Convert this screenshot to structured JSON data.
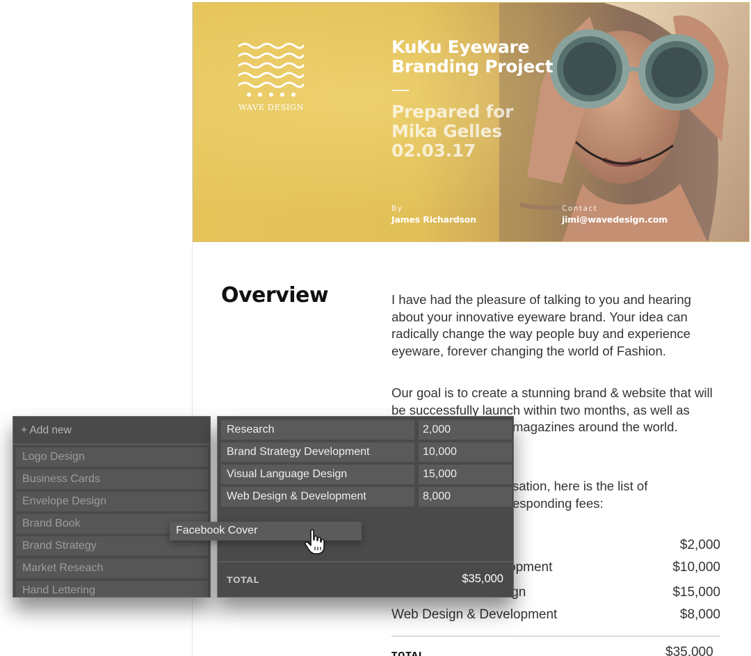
{
  "hero": {
    "logo_text": "WAVE DESIGN",
    "title_line1": "KuKu Eyeware",
    "title_line2": "Branding Project",
    "prepared_line1": "Prepared for",
    "prepared_line2": "Mika Gelles",
    "prepared_line3": "02.03.17",
    "by_label": "By",
    "by_value": "James Richardson",
    "contact_label": "Contact",
    "contact_value": "jimi@wavedesign.com"
  },
  "overview": {
    "heading": "Overview",
    "para1": "I have had the pleasure of talking to you and hearing about your innovative eyeware brand. Your idea can radically change the way people buy and experience eyeware, forever changing the world of Fashion.",
    "para2": "Our goal is to create a stunning brand & website that will be successfully launch within two months, as well as",
    "para2_tail": "magazines around the world.",
    "para3_tail1": "sation, here is the list of",
    "para3_tail2": "esponding fees:"
  },
  "doc_fees": {
    "rows": [
      {
        "name": "",
        "amount": "$2,000"
      },
      {
        "name": "opment",
        "amount": "$10,000"
      },
      {
        "name": "ign",
        "amount": "$15,000"
      },
      {
        "name": "Web Design & Development",
        "amount": "$8,000"
      }
    ],
    "total_label": "TOTAL",
    "total_amount": "$35,000"
  },
  "library_panel": {
    "add_new": "+ Add new",
    "items": [
      "Logo Design",
      "Business Cards",
      "Envelope Design",
      "Brand Book",
      "Brand Strategy",
      "Market Reseach",
      "Hand Lettering"
    ]
  },
  "services_panel": {
    "rows": [
      {
        "name": "Research",
        "cost": "2,000"
      },
      {
        "name": "Brand Strategy Development",
        "cost": "10,000"
      },
      {
        "name": "Visual Language Design",
        "cost": "15,000"
      },
      {
        "name": "Web Design & Development",
        "cost": "8,000"
      }
    ],
    "total_label": "TOTAL",
    "total_amount": "$35,000"
  },
  "drag_item": {
    "label": "Facebook Cover"
  },
  "colors": {
    "hero_yellow": "#e2c058",
    "panel_bg": "#4a4a4a",
    "item_bg": "#565656"
  }
}
